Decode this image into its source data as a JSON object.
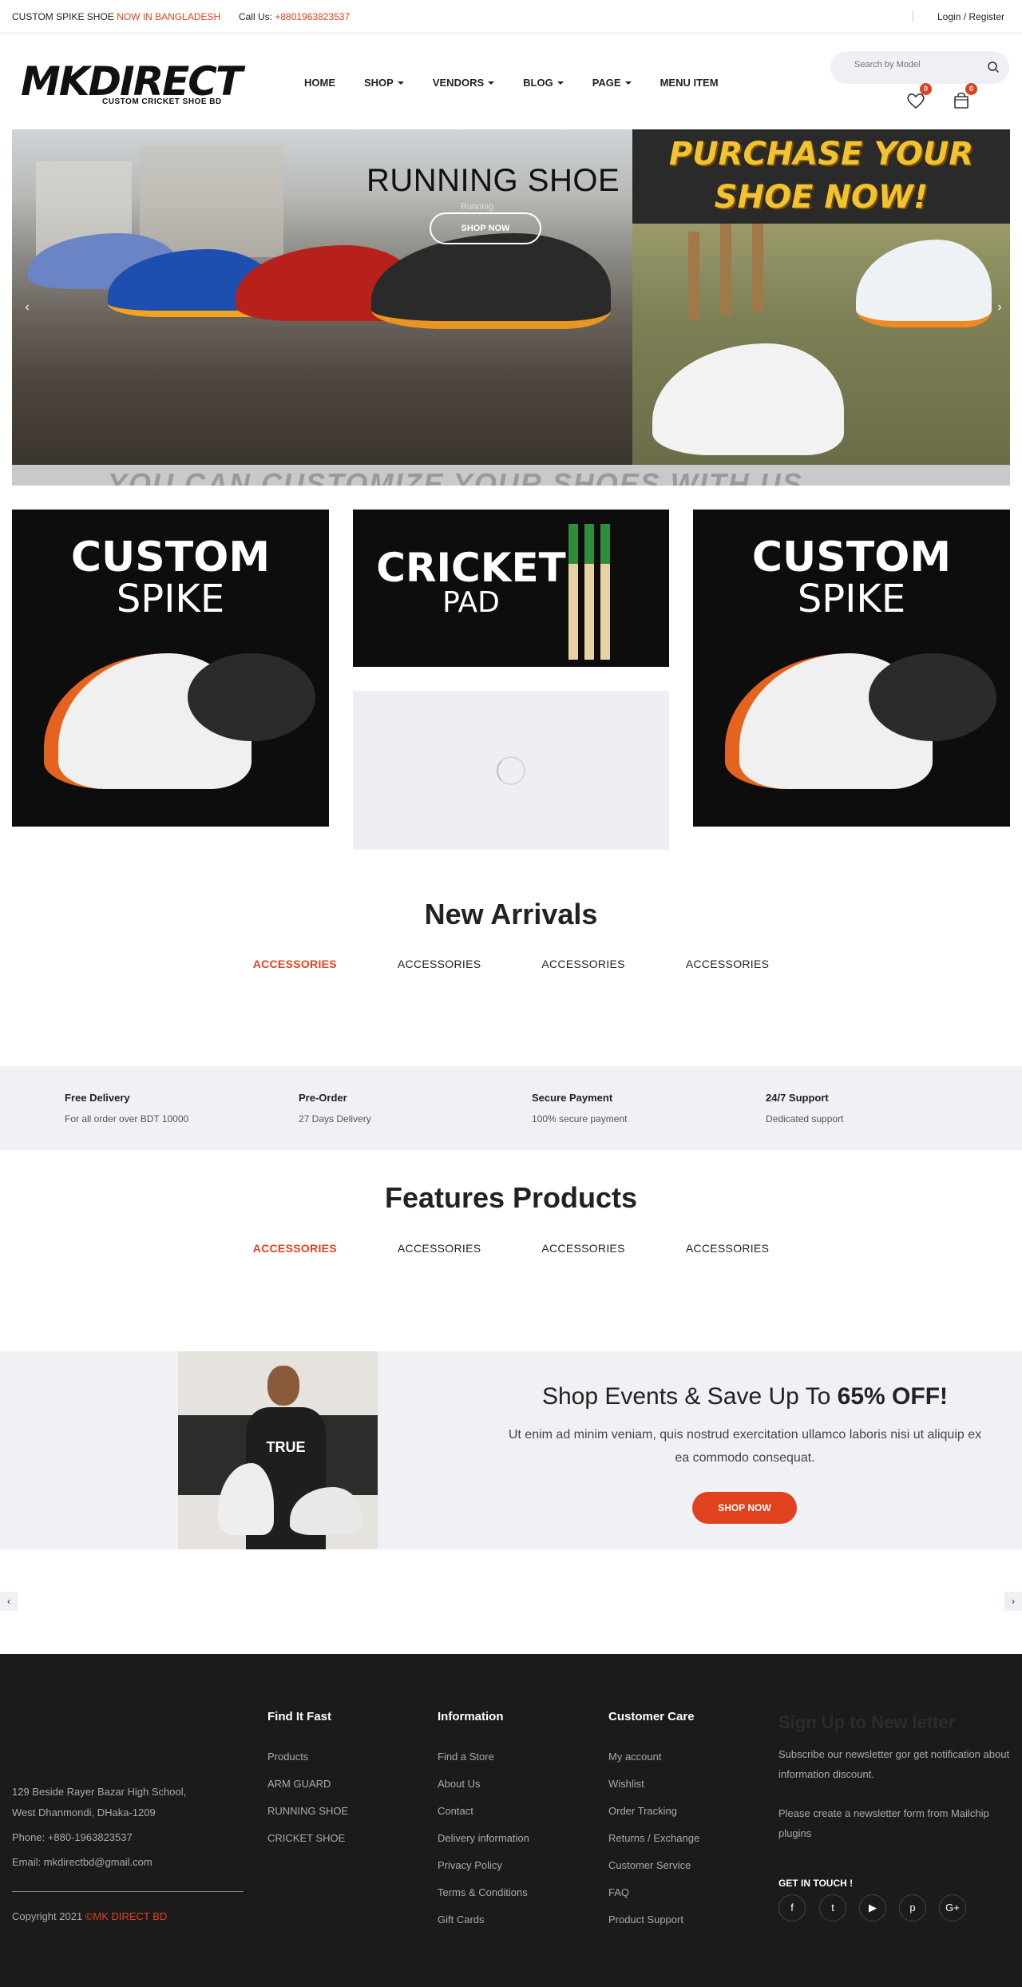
{
  "topbar": {
    "brand_text": "CUSTOM SPIKE SHOE",
    "brand_highlight": "NOW IN BANGLADESH",
    "call_label": "Call Us:",
    "call_number": "+8801963823537",
    "login": "Login / Register"
  },
  "header": {
    "logo_main": "MKDIRECT",
    "logo_sub": "CUSTOM CRICKET SHOE BD",
    "nav": [
      {
        "label": "HOME",
        "dropdown": false
      },
      {
        "label": "SHOP",
        "dropdown": true
      },
      {
        "label": "VENDORS",
        "dropdown": true
      },
      {
        "label": "BLOG",
        "dropdown": true
      },
      {
        "label": "PAGE",
        "dropdown": true
      },
      {
        "label": "MENU ITEM",
        "dropdown": false
      }
    ],
    "search_placeholder": "Search by Model",
    "wishlist_count": "0",
    "cart_count": "0"
  },
  "hero": {
    "title": "RUNNING SHOE",
    "subtitle": "Running",
    "button": "SHOP NOW",
    "promo_line1": "PURCHASE YOUR",
    "promo_line2": "SHOE NOW!",
    "strip_text": "YOU CAN CUSTOMIZE YOUR SHOES WITH US"
  },
  "banners": [
    {
      "title": "CUSTOM",
      "subtitle": "SPIKE"
    },
    {
      "title": "CRICKET",
      "subtitle": "PAD"
    },
    {
      "title": "CUSTOM",
      "subtitle": "SPIKE"
    }
  ],
  "new_arrivals": {
    "title": "New Arrivals",
    "tabs": [
      "ACCESSORIES",
      "ACCESSORIES",
      "ACCESSORIES",
      "ACCESSORIES"
    ]
  },
  "features": [
    {
      "title": "Free Delivery",
      "text": "For all order over BDT 10000"
    },
    {
      "title": "Pre-Order",
      "text": "27 Days Delivery"
    },
    {
      "title": "Secure Payment",
      "text": "100% secure payment"
    },
    {
      "title": "24/7 Support",
      "text": "Dedicated support"
    }
  ],
  "features_products": {
    "title": "Features Products",
    "tabs": [
      "ACCESSORIES",
      "ACCESSORIES",
      "ACCESSORIES",
      "ACCESSORIES"
    ]
  },
  "promo": {
    "heading": "Shop Events & Save Up To",
    "heading_bold": "65% OFF!",
    "text": "Ut enim ad minim veniam, quis nostrud exercitation ullamco laboris nisi ut aliquip ex ea commodo consequat.",
    "button": "SHOP NOW",
    "shirt_text": "TRUE"
  },
  "footer": {
    "address_line1": "129 Beside Rayer Bazar High School,",
    "address_line2": "West Dhanmondi, DHaka-1209",
    "phone": "Phone: +880-1963823537",
    "email": "Email: mkdirectbd@gmail.com",
    "copyright": "Copyright 2021",
    "copyright_brand": "©MK DIRECT BD",
    "find_title": "Find It Fast",
    "find_links": [
      "Products",
      "ARM GUARD",
      "RUNNING SHOE",
      "CRICKET SHOE"
    ],
    "info_title": "Information",
    "info_links": [
      "Find a Store",
      "About Us",
      "Contact",
      "Delivery information",
      "Privacy Policy",
      "Terms & Conditions",
      "Gift Cards"
    ],
    "care_title": "Customer Care",
    "care_links": [
      "My account",
      "Wishlist",
      "Order Tracking",
      "Returns / Exchange",
      "Customer Service",
      "FAQ",
      "Product Support"
    ],
    "newsletter_title": "Sign Up to New letter",
    "newsletter_text": "Subscribe our newsletter gor get notification about information discount.",
    "newsletter_note": "Please create a newsletter form from Mailchip plugins",
    "touch_title": "GET IN TOUCH !",
    "social": [
      "f",
      "t",
      "▶",
      "p",
      "G+"
    ]
  }
}
